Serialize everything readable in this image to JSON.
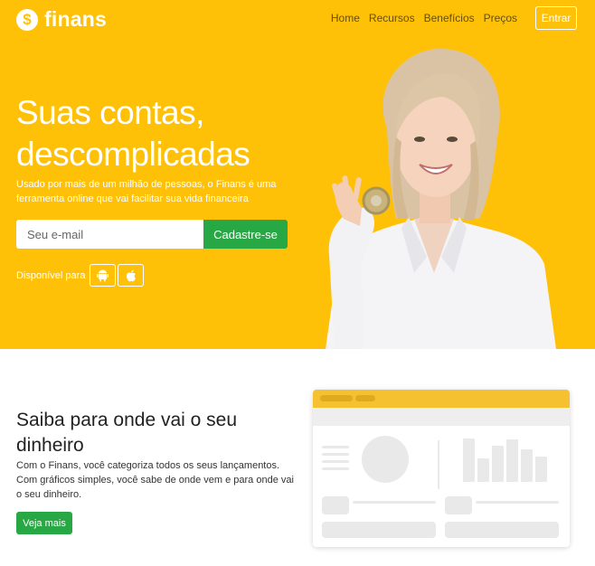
{
  "brand": {
    "name": "finans",
    "coin_symbol": "$",
    "accent": "#ffc107",
    "action_color": "#28a745"
  },
  "nav": {
    "items": [
      "Home",
      "Recursos",
      "Benefícios",
      "Preços"
    ],
    "login_label": "Entrar"
  },
  "hero": {
    "title": "Suas contas, descomplicadas",
    "subtitle": "Usado por mais de um milhão de pessoas, o Finans é uma ferramenta online que vai facilitar sua vida financeira",
    "email_placeholder": "Seu e-mail",
    "email_value": "",
    "signup_label": "Cadastre-se",
    "available_label": "Disponível para",
    "platforms": [
      "android-icon",
      "apple-icon"
    ]
  },
  "feature": {
    "title": "Saiba para onde vai o seu dinheiro",
    "text": "Com o Finans, você categoriza todos os seus lançamentos. Com gráficos simples, você sabe de onde vem e para onde vai o seu dinheiro.",
    "button_label": "Veja mais"
  }
}
